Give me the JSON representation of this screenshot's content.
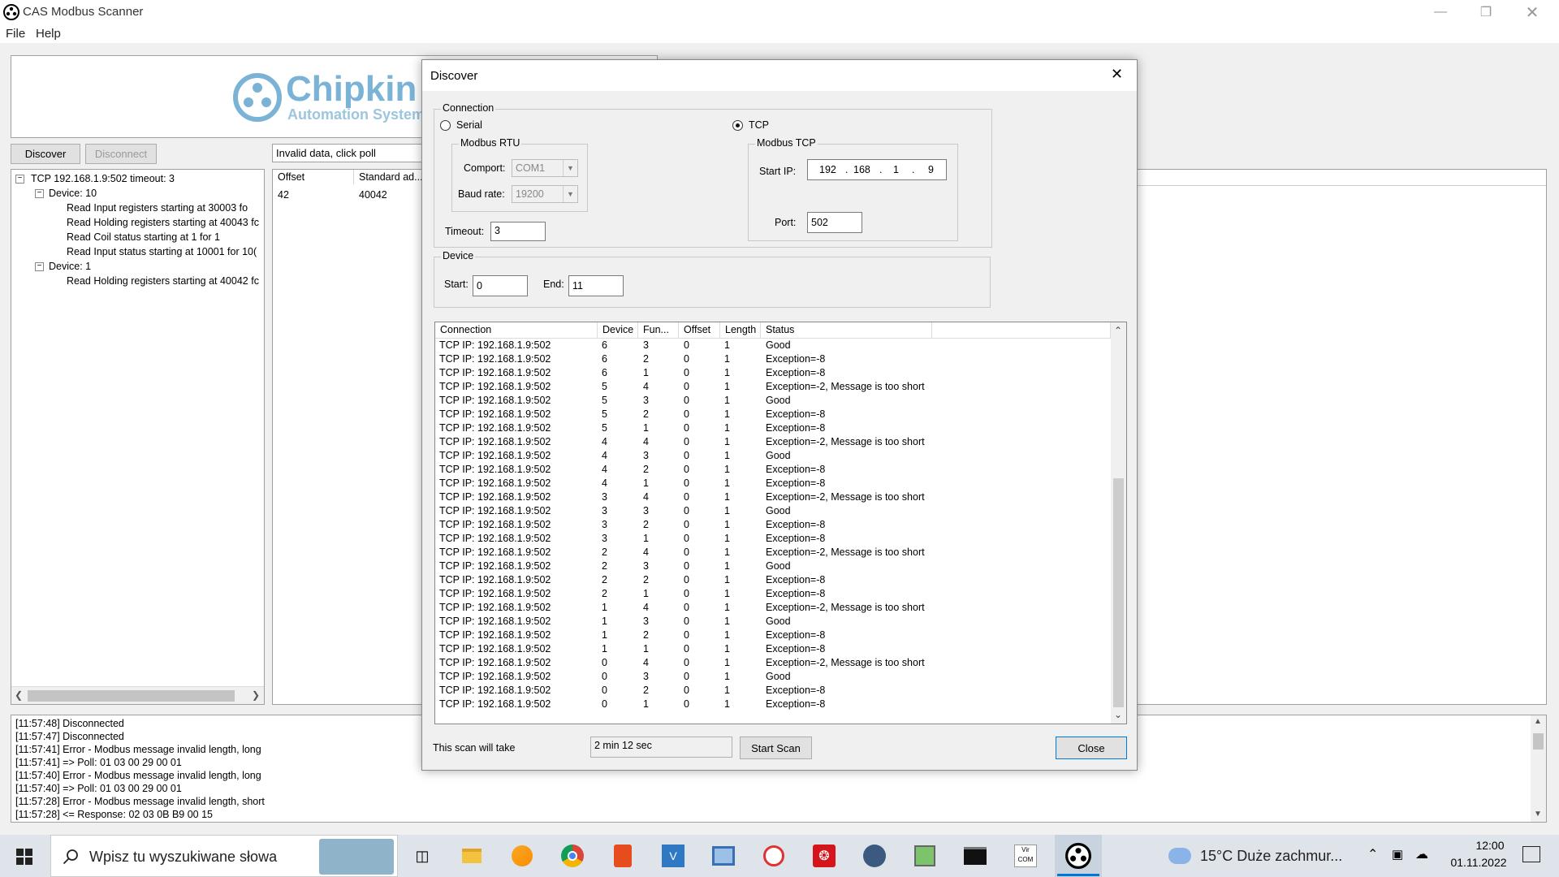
{
  "window": {
    "title": "CAS Modbus Scanner"
  },
  "menu": [
    "File",
    "Help"
  ],
  "logo": {
    "name": "Chipkin",
    "subtitle": "Automation System"
  },
  "toolbar": {
    "discover": "Discover",
    "disconnect": "Disconnect"
  },
  "status_field": "Invalid data, click poll",
  "tree": {
    "root": "TCP 192.168.1.9:502 timeout: 3",
    "device10": "Device: 10",
    "d10_items": [
      "Read Input registers starting at 30003 fo",
      "Read Holding registers starting at 40043 fc",
      "Read Coil status starting at 1 for 1",
      "Read Input status starting at 10001 for 10("
    ],
    "device1": "Device: 1",
    "d1_items": [
      "Read Holding registers starting at 40042 fc"
    ]
  },
  "data_table": {
    "headers": [
      "Offset",
      "Standard ad..."
    ],
    "row": [
      "42",
      "40042"
    ]
  },
  "log": [
    "[11:57:48] Disconnected",
    "[11:57:47] Disconnected",
    "[11:57:41] Error - Modbus message invalid length, long",
    "[11:57:41] => Poll: 01 03 00 29 00 01",
    "[11:57:40] Error - Modbus message invalid length, long",
    "[11:57:40] => Poll: 01 03 00 29 00 01",
    "[11:57:28] Error - Modbus message invalid length, short",
    "[11:57:28] <= Response: 02 03 0B B9 00 15"
  ],
  "dialog": {
    "title": "Discover",
    "connection_label": "Connection",
    "serial_label": "Serial",
    "tcp_label": "TCP",
    "rtu_group": "Modbus RTU",
    "comport_label": "Comport:",
    "comport_value": "COM1",
    "baud_label": "Baud rate:",
    "baud_value": "19200",
    "timeout_label": "Timeout:",
    "timeout_value": "3",
    "tcp_group": "Modbus TCP",
    "startip_label": "Start IP:",
    "ip": [
      "192",
      "168",
      "1",
      "9"
    ],
    "port_label": "Port:",
    "port_value": "502",
    "device_group": "Device",
    "start_label": "Start:",
    "start_value": "0",
    "end_label": "End:",
    "end_value": "11",
    "list_headers": [
      "Connection",
      "Device",
      "Fun...",
      "Offset",
      "Length",
      "Status"
    ],
    "rows": [
      [
        "TCP IP: 192.168.1.9:502",
        "6",
        "3",
        "0",
        "1",
        "Good"
      ],
      [
        "TCP IP: 192.168.1.9:502",
        "6",
        "2",
        "0",
        "1",
        "Exception=-8"
      ],
      [
        "TCP IP: 192.168.1.9:502",
        "6",
        "1",
        "0",
        "1",
        "Exception=-8"
      ],
      [
        "TCP IP: 192.168.1.9:502",
        "5",
        "4",
        "0",
        "1",
        "Exception=-2, Message is too short"
      ],
      [
        "TCP IP: 192.168.1.9:502",
        "5",
        "3",
        "0",
        "1",
        "Good"
      ],
      [
        "TCP IP: 192.168.1.9:502",
        "5",
        "2",
        "0",
        "1",
        "Exception=-8"
      ],
      [
        "TCP IP: 192.168.1.9:502",
        "5",
        "1",
        "0",
        "1",
        "Exception=-8"
      ],
      [
        "TCP IP: 192.168.1.9:502",
        "4",
        "4",
        "0",
        "1",
        "Exception=-2, Message is too short"
      ],
      [
        "TCP IP: 192.168.1.9:502",
        "4",
        "3",
        "0",
        "1",
        "Good"
      ],
      [
        "TCP IP: 192.168.1.9:502",
        "4",
        "2",
        "0",
        "1",
        "Exception=-8"
      ],
      [
        "TCP IP: 192.168.1.9:502",
        "4",
        "1",
        "0",
        "1",
        "Exception=-8"
      ],
      [
        "TCP IP: 192.168.1.9:502",
        "3",
        "4",
        "0",
        "1",
        "Exception=-2, Message is too short"
      ],
      [
        "TCP IP: 192.168.1.9:502",
        "3",
        "3",
        "0",
        "1",
        "Good"
      ],
      [
        "TCP IP: 192.168.1.9:502",
        "3",
        "2",
        "0",
        "1",
        "Exception=-8"
      ],
      [
        "TCP IP: 192.168.1.9:502",
        "3",
        "1",
        "0",
        "1",
        "Exception=-8"
      ],
      [
        "TCP IP: 192.168.1.9:502",
        "2",
        "4",
        "0",
        "1",
        "Exception=-2, Message is too short"
      ],
      [
        "TCP IP: 192.168.1.9:502",
        "2",
        "3",
        "0",
        "1",
        "Good"
      ],
      [
        "TCP IP: 192.168.1.9:502",
        "2",
        "2",
        "0",
        "1",
        "Exception=-8"
      ],
      [
        "TCP IP: 192.168.1.9:502",
        "2",
        "1",
        "0",
        "1",
        "Exception=-8"
      ],
      [
        "TCP IP: 192.168.1.9:502",
        "1",
        "4",
        "0",
        "1",
        "Exception=-2, Message is too short"
      ],
      [
        "TCP IP: 192.168.1.9:502",
        "1",
        "3",
        "0",
        "1",
        "Good"
      ],
      [
        "TCP IP: 192.168.1.9:502",
        "1",
        "2",
        "0",
        "1",
        "Exception=-8"
      ],
      [
        "TCP IP: 192.168.1.9:502",
        "1",
        "1",
        "0",
        "1",
        "Exception=-8"
      ],
      [
        "TCP IP: 192.168.1.9:502",
        "0",
        "4",
        "0",
        "1",
        "Exception=-2, Message is too short"
      ],
      [
        "TCP IP: 192.168.1.9:502",
        "0",
        "3",
        "0",
        "1",
        "Good"
      ],
      [
        "TCP IP: 192.168.1.9:502",
        "0",
        "2",
        "0",
        "1",
        "Exception=-8"
      ],
      [
        "TCP IP: 192.168.1.9:502",
        "0",
        "1",
        "0",
        "1",
        "Exception=-8"
      ]
    ],
    "scan_label": "This scan will take",
    "scan_time": "2 min 12 sec",
    "start_scan": "Start Scan",
    "close": "Close"
  },
  "taskbar": {
    "search_placeholder": "Wpisz tu wyszukiwane słowa",
    "weather": "15°C  Duże zachmur...",
    "time": "12:00",
    "date": "01.11.2022",
    "icons": [
      "task-view-icon",
      "file-explorer-icon",
      "edge-icon",
      "chrome-icon",
      "office-icon",
      "vc-icon",
      "network-icon",
      "paint-icon",
      "acrobat-icon",
      "app-icon",
      "image-icon",
      "terminal-icon",
      "vircom-icon",
      "cas-icon"
    ]
  },
  "colors": {
    "accent": "#0078d7",
    "logo": "#7ab3d6"
  }
}
